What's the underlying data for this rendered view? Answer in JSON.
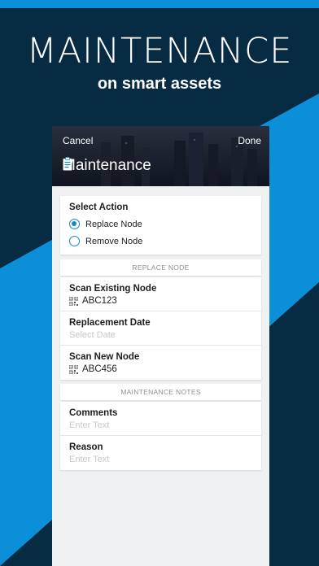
{
  "hero": {
    "title": "MAINTENANCE",
    "subtitle": "on smart assets"
  },
  "colors": {
    "navy": "#082b44",
    "blue": "#0b8fd8",
    "accent": "#1687c9"
  },
  "header": {
    "cancel": "Cancel",
    "done": "Done",
    "title": "Maintenance",
    "icon": "clipboard-icon"
  },
  "select_action": {
    "label": "Select Action",
    "options": [
      {
        "label": "Replace Node",
        "selected": true
      },
      {
        "label": "Remove Node",
        "selected": false
      }
    ]
  },
  "replace_section": {
    "header": "REPLACE NODE",
    "scan_existing": {
      "label": "Scan Existing Node",
      "value": "ABC123",
      "icon": "qr-code-icon"
    },
    "replacement_date": {
      "label": "Replacement Date",
      "placeholder": "Select Date"
    },
    "scan_new": {
      "label": "Scan New Node",
      "value": "ABC456",
      "icon": "qr-code-icon"
    }
  },
  "notes_section": {
    "header": "MAINTENANCE NOTES",
    "comments": {
      "label": "Comments",
      "placeholder": "Enter Text"
    },
    "reason": {
      "label": "Reason",
      "placeholder": "Enter Text"
    }
  }
}
